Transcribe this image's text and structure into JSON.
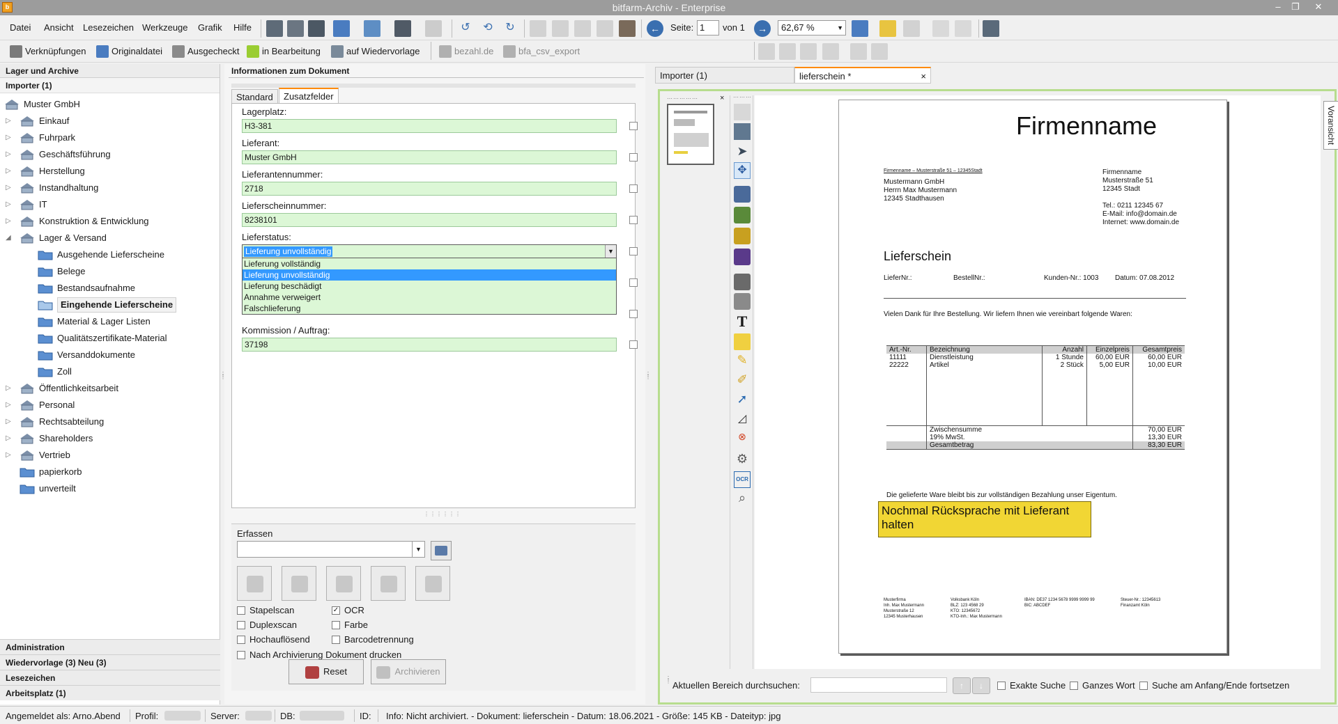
{
  "window": {
    "title": "bitfarm-Archiv - Enterprise"
  },
  "menu": [
    "Datei",
    "Ansicht",
    "Lesezeichen",
    "Werkzeuge",
    "Grafik",
    "Hilfe"
  ],
  "toolbar": {
    "rotate_left": "90°",
    "rotate_180": "180°",
    "rotate_right": "90°",
    "page_label": "Seite:",
    "page_value": "1",
    "page_of": "von 1",
    "zoom_value": "62,67 %"
  },
  "toolbar2": {
    "links": "Verknüpfungen",
    "original": "Originaldatei",
    "checked_out": "Ausgecheckt",
    "in_progress": "in Bearbeitung",
    "followup": "auf Wiedervorlage",
    "plugin1": "bezahl.de",
    "plugin2": "bfa_csv_export"
  },
  "left": {
    "header": "Lager und Archive",
    "importer": "Importer (1)",
    "root": "Muster GmbH",
    "tree": [
      {
        "label": "Einkauf",
        "level": 1,
        "exp": "▷"
      },
      {
        "label": "Fuhrpark",
        "level": 1,
        "exp": "▷"
      },
      {
        "label": "Geschäftsführung",
        "level": 1,
        "exp": "▷"
      },
      {
        "label": "Herstellung",
        "level": 1,
        "exp": "▷"
      },
      {
        "label": "Instandhaltung",
        "level": 1,
        "exp": "▷"
      },
      {
        "label": "IT",
        "level": 1,
        "exp": "▷"
      },
      {
        "label": "Konstruktion & Entwicklung",
        "level": 1,
        "exp": "▷"
      },
      {
        "label": "Lager & Versand",
        "level": 1,
        "exp": "◢"
      },
      {
        "label": "Ausgehende Lieferscheine",
        "level": 2
      },
      {
        "label": "Belege",
        "level": 2
      },
      {
        "label": "Bestandsaufnahme",
        "level": 2
      },
      {
        "label": "Eingehende Lieferscheine",
        "level": 2,
        "selected": true
      },
      {
        "label": "Material & Lager Listen",
        "level": 2
      },
      {
        "label": "Qualitätszertifikate-Material",
        "level": 2
      },
      {
        "label": "Versanddokumente",
        "level": 2
      },
      {
        "label": "Zoll",
        "level": 2
      },
      {
        "label": "Öffentlichkeitsarbeit",
        "level": 1,
        "exp": "▷"
      },
      {
        "label": "Personal",
        "level": 1,
        "exp": "▷"
      },
      {
        "label": "Rechtsabteilung",
        "level": 1,
        "exp": "▷"
      },
      {
        "label": "Shareholders",
        "level": 1,
        "exp": "▷"
      },
      {
        "label": "Vertrieb",
        "level": 1,
        "exp": "▷"
      },
      {
        "label": "papierkorb",
        "level": 1
      },
      {
        "label": "unverteilt",
        "level": 1
      }
    ],
    "footer": [
      "Administration",
      "Wiedervorlage (3)  Neu (3)",
      "Lesezeichen",
      "Arbeitsplatz (1)"
    ]
  },
  "info": {
    "header": "Informationen zum Dokument",
    "tab_standard": "Standard",
    "tab_extra": "Zusatzfelder",
    "fields": {
      "lagerplatz_label": "Lagerplatz:",
      "lagerplatz": "H3-381",
      "lieferant_label": "Lieferant:",
      "lieferant": "Muster GmbH",
      "lieferantennummer_label": "Lieferantennummer:",
      "lieferantennummer": "2718",
      "lieferscheinnummer_label": "Lieferscheinnummer:",
      "lieferscheinnummer": "8238101",
      "lieferstatus_label": "Lieferstatus:",
      "lieferstatus": "Lieferung unvollständig",
      "kommission_label": "Kommission / Auftrag:",
      "kommission": "37198"
    },
    "status_options": [
      "Lieferung vollständig",
      "Lieferung unvollständig",
      "Lieferung beschädigt",
      "Annahme verweigert",
      "Falschlieferung"
    ],
    "highlighted_option": "Lieferung unvollständig"
  },
  "capture": {
    "label": "Erfassen",
    "checkboxes": [
      {
        "label": "Stapelscan",
        "checked": false
      },
      {
        "label": "OCR",
        "checked": true
      },
      {
        "label": "Duplexscan",
        "checked": false
      },
      {
        "label": "Farbe",
        "checked": false
      },
      {
        "label": "Hochauflösend",
        "checked": false
      },
      {
        "label": "Barcodetrennung",
        "checked": false
      },
      {
        "label": "Nach Archivierung Dokument drucken",
        "checked": false
      }
    ],
    "reset": "Reset",
    "archive": "Archivieren"
  },
  "viewer": {
    "tab_importer": "Importer (1)",
    "tab_doc": "lieferschein *",
    "close": "×",
    "vorschau": "Voransicht",
    "search_label": "Aktuellen Bereich durchsuchen:",
    "exact": "Exakte Suche",
    "whole": "Ganzes Wort",
    "wrap": "Suche am Anfang/Ende fortsetzen"
  },
  "document": {
    "company": "Firmenname",
    "sender_line": "Firmenname – Musterstraße 51 – 12345Stadt",
    "recipient": [
      "Mustermann GmbH",
      "Herrn Max Mustermann",
      "12345 Stadthausen"
    ],
    "sender": [
      "Firmenname",
      "Musterstraße 51",
      "12345 Stadt"
    ],
    "contact": [
      "Tel.: 0211 12345 67",
      "E-Mail: info@domain.de",
      "Internet: www.domain.de"
    ],
    "title": "Lieferschein",
    "meta": {
      "liefer": "LieferNr.:",
      "bestell": "BestellNr.:",
      "kunde": "Kunden-Nr.: 1003",
      "datum": "Datum: 07.08.2012"
    },
    "intro": "Vielen Dank für Ihre Bestellung. Wir liefern Ihnen wie vereinbart folgende Waren:",
    "table_headers": [
      "Art.-Nr.",
      "Bezeichnung",
      "Anzahl",
      "Einzelpreis",
      "Gesamtpreis"
    ],
    "rows": [
      [
        "11111",
        "Dienstleistung",
        "1 Stunde",
        "60,00 EUR",
        "60,00 EUR"
      ],
      [
        "22222",
        "Artikel",
        "2 Stück",
        "5,00 EUR",
        "10,00 EUR"
      ]
    ],
    "subtotal_label": "Zwischensumme",
    "subtotal": "70,00 EUR",
    "vat_label": "19% MwSt.",
    "vat": "13,30 EUR",
    "total_label": "Gesamtbetrag",
    "total": "83,30 EUR",
    "note": "Die gelieferte Ware bleibt bis zur vollständigen Bezahlung unser Eigentum.",
    "sticky": "Nochmal Rücksprache mit Lieferant halten",
    "footer_cols": [
      [
        "Musterfirma",
        "Inh. Max Mustermann",
        "Musterstraße 12",
        "12345 Musterhausen"
      ],
      [
        "Volksbank Köln",
        "BLZ: 123 4568 29",
        "KTO: 12345672",
        "KTO-Inh.: Max Mustermann"
      ],
      [
        "IBAN: DE37 1234 5678 9999 9999 99",
        "BIC: ABCDEF"
      ],
      [
        "Steuer-Nr.: 12345613",
        "Finanzamt Köln"
      ]
    ]
  },
  "status": {
    "user": "Angemeldet als:  Arno.Abend",
    "profile": "Profil:",
    "server": "Server:",
    "db": "DB:",
    "id": "ID:",
    "info": "Info:  Nicht archiviert. - Dokument: lieferschein - Datum: 18.06.2021 - Größe: 145 KB - Dateityp: jpg"
  }
}
